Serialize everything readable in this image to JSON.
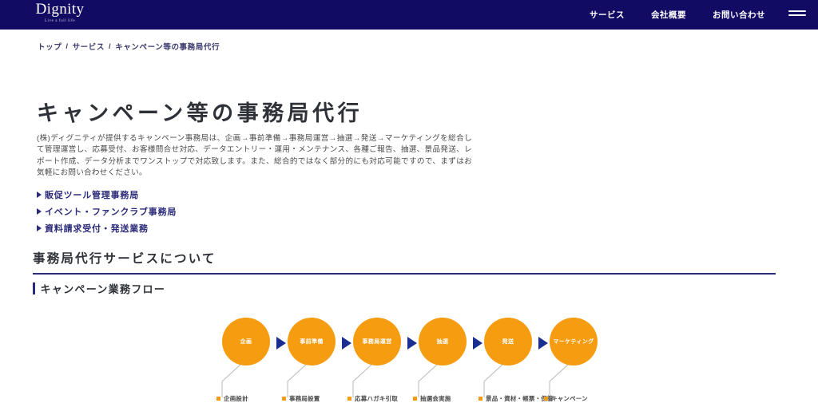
{
  "header": {
    "logo": {
      "name": "Dignity",
      "tagline": "Live a full life"
    },
    "nav": [
      {
        "label": "サービス"
      },
      {
        "label": "会社概要"
      },
      {
        "label": "お問い合わせ"
      }
    ],
    "menu_icon": "hamburger-icon"
  },
  "breadcrumb": {
    "items": [
      {
        "label": "トップ"
      },
      {
        "label": "サービス"
      },
      {
        "label": "キャンペーン等の事務局代行"
      }
    ],
    "separator": "/"
  },
  "main": {
    "title": "キャンペーン等の事務局代行",
    "description": "(株)ディグニティが提供するキャンペーン事務局は、企画→事前準備→事務局運営→抽選→発送→マーケティングを総合して管理運営し、応募受付、お客様問合せ対応、データエントリー・運用・メンテナンス、各種ご報告、抽選、景品発送、レポート作成、データ分析までワンストップで対応致します。また、総合的ではなく部分的にも対応可能ですので、まずはお気軽にお問い合わせください。",
    "links": [
      {
        "label": "販促ツール管理事務局"
      },
      {
        "label": "イベント・ファンクラブ事務局"
      },
      {
        "label": "資料請求受付・発送業務"
      }
    ],
    "section_heading": "事務局代行サービスについて",
    "sub_heading": "キャンペーン業務フロー"
  },
  "flow": {
    "steps": [
      {
        "circle": "企画",
        "leaf": "企画設計"
      },
      {
        "circle": "事前準備",
        "leaf": "事務局設置"
      },
      {
        "circle": "事務局運営",
        "leaf": "応募ハガキ引取"
      },
      {
        "circle": "抽選",
        "leaf": "抽選会実施"
      },
      {
        "circle": "発送",
        "leaf": "景品・資材・帳票・保管"
      },
      {
        "circle": "マーケティング",
        "leaf": "キャンペーン"
      }
    ]
  },
  "colors": {
    "header_bg": "#120b63",
    "accent_navy": "#2b2b7a",
    "accent_orange": "#f59c10",
    "arrow_navy": "#1a2f8f",
    "text_dark": "#2e3238",
    "text_body": "#4a4a4a"
  }
}
